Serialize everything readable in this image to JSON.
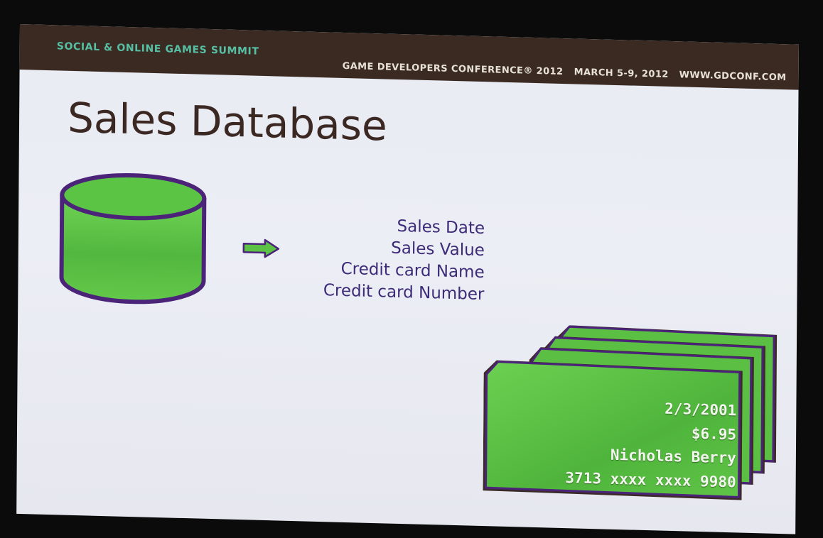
{
  "header": {
    "summit": "SOCIAL & ONLINE GAMES SUMMIT",
    "conference": "GAME DEVELOPERS CONFERENCE® 2012",
    "dates": "MARCH 5-9, 2012",
    "website": "WWW.GDCONF.COM"
  },
  "slide": {
    "title": "Sales Database",
    "fields": [
      "Sales Date",
      "Sales Value",
      "Credit card Name",
      "Credit card Number"
    ],
    "record": {
      "date": "2/3/2001",
      "value": "$6.95",
      "name": "Nicholas Berry",
      "number": "3713 xxxx xxxx 9980"
    }
  },
  "icons": {
    "database": "database-icon",
    "arrow": "arrow-right-icon",
    "records": "record-cards-icon"
  },
  "colors": {
    "banner": "#3a2a22",
    "summit_text": "#55c0a4",
    "title_text": "#3b2823",
    "field_text": "#3d2b78",
    "shape_fill": "#5cc246",
    "shape_outline": "#4b2378",
    "slide_background": "#e9ebf3"
  }
}
